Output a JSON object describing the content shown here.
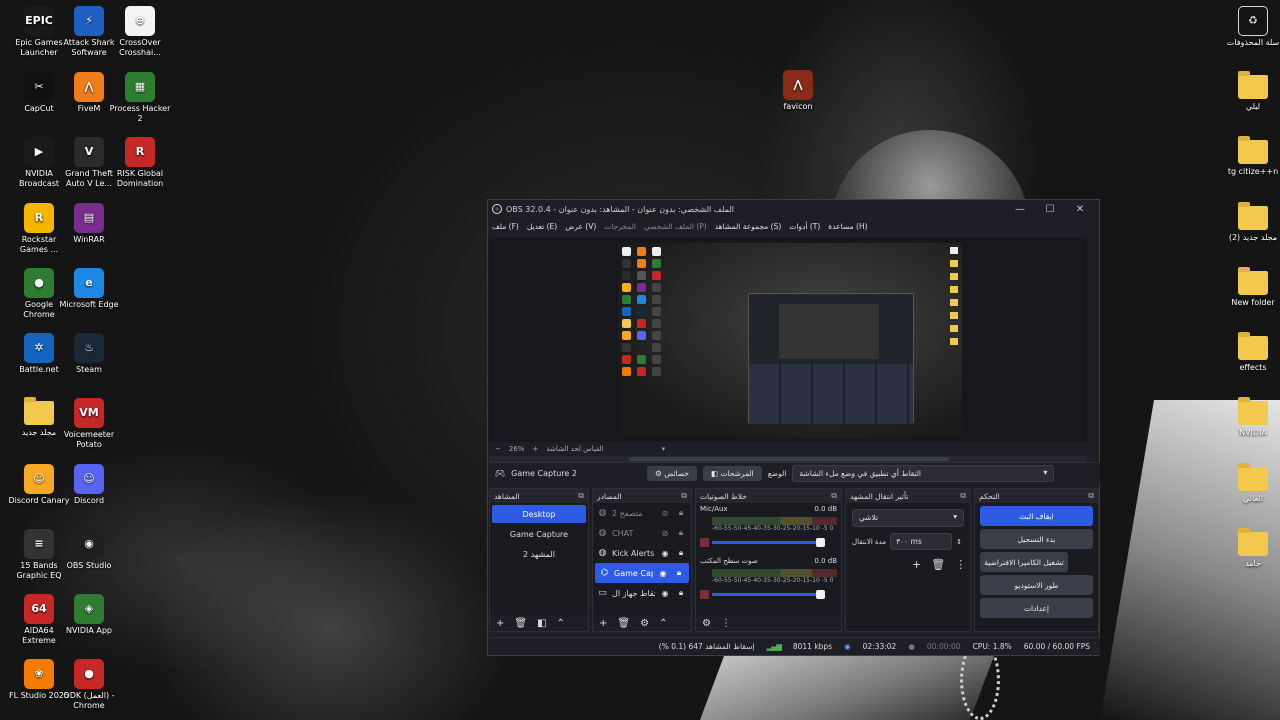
{
  "desktop_left": [
    {
      "label": "Epic Games Launcher",
      "icon": "epic-games-icon",
      "color": "#1a1a1a",
      "glyph": "EPIC"
    },
    {
      "label": "Attack Shark Software",
      "icon": "attack-shark-icon",
      "color": "#1f5fbf",
      "glyph": "⚡"
    },
    {
      "label": "CrossOver Crosshai...",
      "icon": "crosshair-icon",
      "color": "#f4f4f4",
      "glyph": "⊕"
    },
    {
      "label": "CapCut",
      "icon": "capcut-icon",
      "color": "#111111",
      "glyph": "✂"
    },
    {
      "label": "FiveM",
      "icon": "fivem-icon",
      "color": "#f07c1a",
      "glyph": "⋀"
    },
    {
      "label": "Process Hacker 2",
      "icon": "process-hacker-icon",
      "color": "#2e7d32",
      "glyph": "▦"
    },
    {
      "label": "NVIDIA Broadcast",
      "icon": "nvidia-broadcast-icon",
      "color": "#1a1a1a",
      "glyph": "▶"
    },
    {
      "label": "Grand Theft Auto V Le...",
      "icon": "gta-icon",
      "color": "#2b2b2b",
      "glyph": "V"
    },
    {
      "label": "RISK Global Domination",
      "icon": "risk-icon",
      "color": "#c62828",
      "glyph": "R"
    },
    {
      "label": "Rockstar Games ...",
      "icon": "rockstar-icon",
      "color": "#f5b400",
      "glyph": "R"
    },
    {
      "label": "WinRAR",
      "icon": "winrar-icon",
      "color": "#7b2d8e",
      "glyph": "▤"
    },
    {
      "label": "Google Chrome",
      "icon": "chrome-icon",
      "color": "#2e7d32",
      "glyph": "●"
    },
    {
      "label": "Microsoft Edge",
      "icon": "edge-icon",
      "color": "#1e88e5",
      "glyph": "e"
    },
    {
      "label": "Battle.net",
      "icon": "battlenet-icon",
      "color": "#1565c0",
      "glyph": "✲"
    },
    {
      "label": "Steam",
      "icon": "steam-icon",
      "color": "#1b2838",
      "glyph": "♨"
    },
    {
      "label": "مجلد جديد",
      "icon": "folder-icon",
      "color": "#f2c94c",
      "glyph": ""
    },
    {
      "label": "Voicemeeter Potato",
      "icon": "voicemeeter-icon",
      "color": "#c62828",
      "glyph": "VM"
    },
    {
      "label": "Discord Canary",
      "icon": "discord-canary-icon",
      "color": "#f9a825",
      "glyph": "☺"
    },
    {
      "label": "Discord",
      "icon": "discord-icon",
      "color": "#5865f2",
      "glyph": "☺"
    },
    {
      "label": "15 Bands Graphic EQ",
      "icon": "eq-icon",
      "color": "#333333",
      "glyph": "≡"
    },
    {
      "label": "OBS Studio",
      "icon": "obs-icon",
      "color": "#202020",
      "glyph": "◉"
    },
    {
      "label": "AIDA64 Extreme",
      "icon": "aida64-icon",
      "color": "#c62828",
      "glyph": "64"
    },
    {
      "label": "NVIDIA App",
      "icon": "nvidia-app-icon",
      "color": "#2e7d32",
      "glyph": "◈"
    },
    {
      "label": "FL Studio 2025",
      "icon": "flstudio-icon",
      "color": "#f57c00",
      "glyph": "❀"
    },
    {
      "label": "ODK (العمل) - Chrome",
      "icon": "chrome-profile-icon",
      "color": "#c62828",
      "glyph": "●"
    }
  ],
  "desktop_right": [
    {
      "label": "سلة المحذوفات",
      "icon": "recycle-bin-icon"
    },
    {
      "label": "ليلي",
      "icon": "folder-icon"
    },
    {
      "label": "tg citize++n",
      "icon": "folder-icon"
    },
    {
      "label": "(2) مجلد جديد",
      "icon": "folder-icon"
    },
    {
      "label": "New folder",
      "icon": "folder-icon"
    },
    {
      "label": "effects",
      "icon": "folder-icon"
    },
    {
      "label": "NVIDIA",
      "icon": "folder-icon"
    },
    {
      "label": "العالي",
      "icon": "folder-icon"
    },
    {
      "label": "جامد",
      "icon": "folder-icon"
    }
  ],
  "desktop_center": {
    "label": "favicon",
    "icon": "favicon-icon"
  },
  "obs": {
    "title": "OBS 32.0.4 - الملف الشخصي: بدون عنوان - المشاهد: بدون عنوان",
    "menu": [
      "ملف (F)",
      "تعديل (E)",
      "عرض (V)",
      "المخرجات",
      "الملف الشخصي (P)",
      "مجموعة المشاهد (S)",
      "أدوات (T)",
      "مساعدة (H)"
    ],
    "preview_zoom": "26%",
    "preview_fit_label": "القياس لحد الشاشة",
    "source_name": "Game Capture 2",
    "properties_label": "خصائص",
    "filters_label": "المرشحات",
    "mode_label": "الوضع",
    "mode_value": "التقاط أي تطبيق في وضع ملء الشاشة",
    "scenes_title": "المشاهد",
    "scenes": [
      {
        "label": "Desktop",
        "active": true
      },
      {
        "label": "Game Capture",
        "active": false
      },
      {
        "label": "المشهد 2",
        "active": false
      }
    ],
    "sources_title": "المصادر",
    "sources": [
      {
        "label": "متصفح 2",
        "icon": "globe-icon",
        "eye": "eye-off-icon",
        "active": false,
        "dim": true
      },
      {
        "label": "CHAT",
        "icon": "globe-icon",
        "eye": "eye-off-icon",
        "active": false,
        "dim": true
      },
      {
        "label": "Kick Alerts",
        "icon": "globe-icon",
        "eye": "eye-icon",
        "active": false,
        "dim": false
      },
      {
        "label": "Game Cap",
        "icon": "gamepad-icon",
        "eye": "eye-icon",
        "active": true,
        "dim": false
      },
      {
        "label": "التقاط جهاز ال",
        "icon": "monitor-icon",
        "eye": "eye-icon",
        "active": false,
        "dim": false
      }
    ],
    "mixer_title": "خلاط الصوتيات",
    "mixer": [
      {
        "name": "Mic/Aux",
        "db": "0.0 dB"
      },
      {
        "name": "صوت سطح المكتب",
        "db": "0.0 dB"
      }
    ],
    "meter_scale": "-60-55-50-45-40-35-30-25-20-15-10 -5 0",
    "transitions_title": "تأثير انتقال المشهد",
    "transition_value": "تلاشي",
    "duration_label": "مدة الانتقال",
    "duration_value": "٣٠٠ ms",
    "controls_title": "التحكم",
    "controls": [
      {
        "label": "ايقاف البث",
        "primary": true
      },
      {
        "label": "بدء التسجيل",
        "primary": false
      },
      {
        "label": "تشغيل الكاميرا الافتراضية",
        "primary": false
      },
      {
        "label": "طور الاستوديو",
        "primary": false
      },
      {
        "label": "إعدادات",
        "primary": false
      }
    ],
    "status": {
      "dropped": "إسقاط المشاهد 647 (0.1 %)",
      "bitrate": "8011 kbps",
      "live_time": "02:33:02",
      "rec_time": "00:00:00",
      "cpu": "CPU: 1.8%",
      "fps": "60.00 / 60.00 FPS"
    }
  }
}
